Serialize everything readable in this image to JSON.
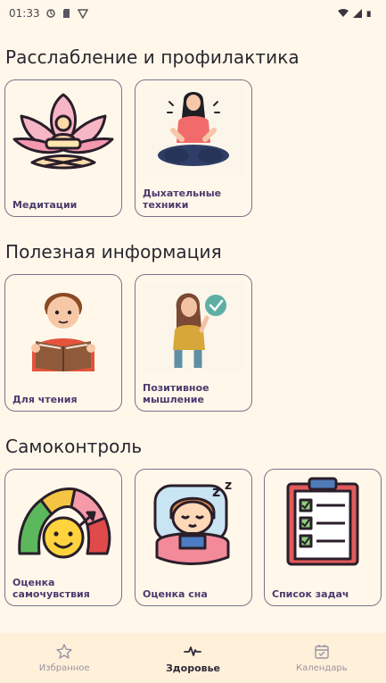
{
  "status_bar": {
    "time": "01:33",
    "left_icons": [
      "location-icon",
      "sd-card-icon",
      "shield-icon"
    ],
    "right_icons": [
      "wifi-icon",
      "signal-icon",
      "battery-icon"
    ]
  },
  "sections": [
    {
      "title": "Расслабление и профилактика",
      "cards": [
        {
          "label": "Медитации",
          "icon": "meditation-icon"
        },
        {
          "label": "Дыхательные техники",
          "icon": "breathing-icon"
        }
      ]
    },
    {
      "title": "Полезная информация",
      "cards": [
        {
          "label": "Для чтения",
          "icon": "reading-icon"
        },
        {
          "label": "Позитивное мышление",
          "icon": "positive-thinking-icon"
        }
      ]
    },
    {
      "title": "Самоконтроль",
      "cards": [
        {
          "label": "Оценка самочувствия",
          "icon": "mood-gauge-icon"
        },
        {
          "label": "Оценка сна",
          "icon": "sleep-icon"
        },
        {
          "label": "Список задач",
          "icon": "checklist-icon"
        }
      ]
    }
  ],
  "bottom_nav": {
    "items": [
      {
        "label": "Избранное",
        "icon": "star-icon",
        "active": false
      },
      {
        "label": "Здоровье",
        "icon": "heartbeat-icon",
        "active": true
      },
      {
        "label": "Календарь",
        "icon": "calendar-check-icon",
        "active": false
      }
    ]
  },
  "colors": {
    "background": "#FFF8EA",
    "card_border": "#7A7288",
    "card_label": "#4B3B6E",
    "nav_background": "#FFF1D9",
    "nav_active": "#2E2938",
    "nav_inactive": "#9B93A4"
  }
}
